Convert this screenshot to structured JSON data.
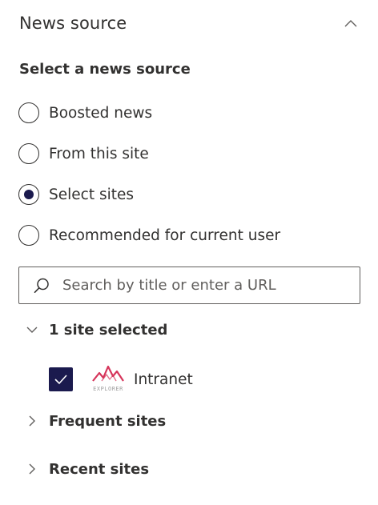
{
  "section": {
    "title": "News source"
  },
  "source": {
    "group_label": "Select a news source",
    "options": [
      {
        "label": "Boosted news",
        "selected": false
      },
      {
        "label": "From this site",
        "selected": false
      },
      {
        "label": "Select sites",
        "selected": true
      },
      {
        "label": "Recommended for current user",
        "selected": false
      }
    ]
  },
  "search": {
    "placeholder": "Search by title or enter a URL",
    "value": ""
  },
  "tree": {
    "selected_group": {
      "label": "1 site selected",
      "expanded": true,
      "sites": [
        {
          "name": "Intranet",
          "checked": true,
          "logo_text": "EXPLORER",
          "logo_color": "#d6345a"
        }
      ]
    },
    "frequent": {
      "label": "Frequent sites",
      "expanded": false
    },
    "recent": {
      "label": "Recent sites",
      "expanded": false
    }
  },
  "colors": {
    "accent": "#1b1a4e",
    "text": "#323130",
    "border": "#605e5c"
  }
}
